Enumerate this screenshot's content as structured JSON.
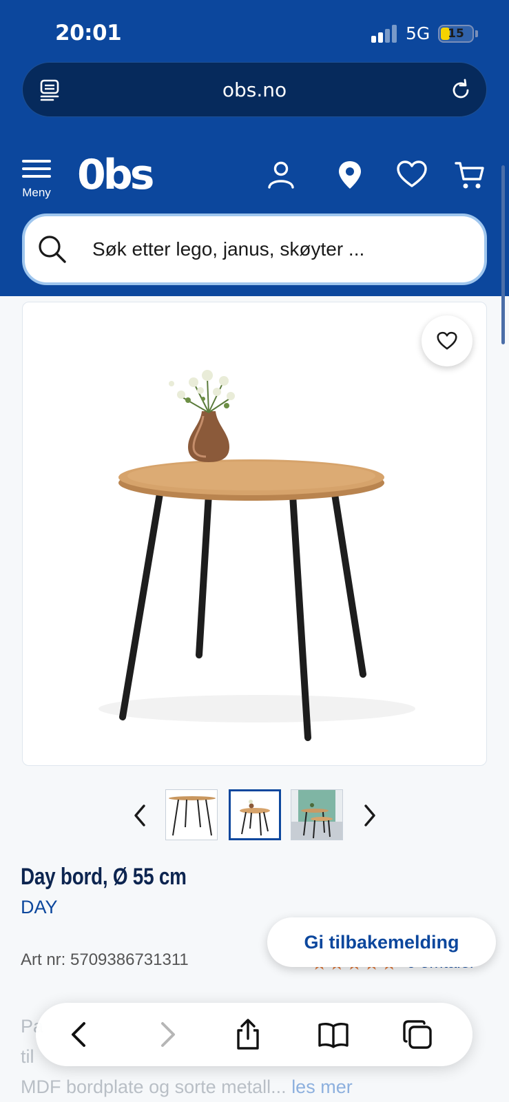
{
  "status_bar": {
    "time": "20:01",
    "network": "5G",
    "battery": "15"
  },
  "browser": {
    "url": "obs.no"
  },
  "header": {
    "menu_label": "Meny",
    "logo_text": "0bs",
    "search_placeholder": "Søk etter lego, janus, skøyter ..."
  },
  "product": {
    "title": "Day bord, Ø 55 cm",
    "brand": "DAY",
    "art_nr": "Art nr: 5709386731311",
    "rating_stars": "★★★★★",
    "rating_text": "6 omtaler",
    "description_lines": [
      "Pa",
      "til",
      "MDF bordplate og sorte metall..."
    ],
    "read_more": "les mer"
  },
  "feedback_button": "Gi tilbakemelding",
  "thumbnails": [
    {
      "name": "thumb-1",
      "active": false
    },
    {
      "name": "thumb-2",
      "active": true
    },
    {
      "name": "thumb-3",
      "active": false
    }
  ],
  "colors": {
    "brand_blue": "#0c479d",
    "url_bar": "#062a5c",
    "star": "#e07a3c"
  },
  "icons": [
    "reader-icon",
    "reload-icon",
    "menu-icon",
    "user-icon",
    "location-pin-icon",
    "heart-icon",
    "cart-icon",
    "search-icon",
    "chevron-left-icon",
    "chevron-right-icon",
    "share-icon",
    "bookmarks-icon",
    "tabs-icon"
  ]
}
